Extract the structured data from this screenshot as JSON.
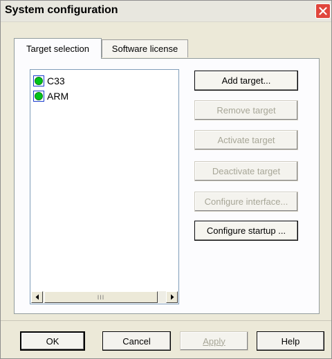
{
  "window": {
    "title": "System configuration"
  },
  "tabs": [
    {
      "label": "Target selection",
      "active": true
    },
    {
      "label": "Software license",
      "active": false
    }
  ],
  "target_list": {
    "items": [
      {
        "label": "C33",
        "status_color": "#00c41a"
      },
      {
        "label": "ARM",
        "status_color": "#00c41a"
      }
    ],
    "scroll_thumb_grip": "III"
  },
  "actions": {
    "add_target": "Add target...",
    "remove_target": "Remove target",
    "activate_target": "Activate target",
    "deactivate_target": "Deactivate target",
    "configure_interface": "Configure interface...",
    "configure_startup": "Configure startup ..."
  },
  "footer": {
    "ok": "OK",
    "cancel": "Cancel",
    "apply": "Apply",
    "help": "Help"
  },
  "colors": {
    "dialog_bg": "#ece9d8",
    "close_button": "#e0463c",
    "disabled_text": "#a7a697",
    "status_active": "#00c41a"
  }
}
